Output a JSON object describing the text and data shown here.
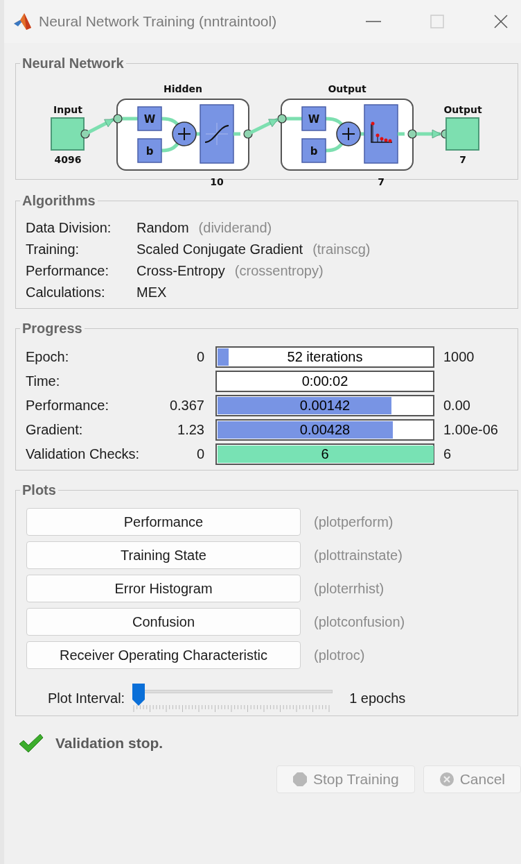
{
  "window": {
    "title": "Neural Network Training (nntraintool)"
  },
  "network": {
    "title": "Neural Network",
    "input": {
      "label": "Input",
      "size": "4096"
    },
    "layers": [
      {
        "name": "Hidden",
        "size": "10",
        "weight": "W",
        "bias": "b",
        "kind": "sigmoid"
      },
      {
        "name": "Output",
        "size": "7",
        "weight": "W",
        "bias": "b",
        "kind": "softmax"
      }
    ],
    "output": {
      "label": "Output",
      "size": "7"
    }
  },
  "algorithms": {
    "title": "Algorithms",
    "rows": [
      {
        "label": "Data Division:",
        "value": "Random",
        "function": "(dividerand)"
      },
      {
        "label": "Training:",
        "value": "Scaled Conjugate Gradient",
        "function": "(trainscg)"
      },
      {
        "label": "Performance:",
        "value": "Cross-Entropy",
        "function": "(crossentropy)"
      },
      {
        "label": "Calculations:",
        "value": "MEX"
      }
    ]
  },
  "progress": {
    "title": "Progress",
    "rows": [
      {
        "label": "Epoch:",
        "start": "0",
        "text": "52 iterations",
        "level": 0.05,
        "color": "#7894e4",
        "end": "1000"
      },
      {
        "label": "Time:",
        "text": "0:00:02"
      },
      {
        "label": "Performance:",
        "start": "0.367",
        "text": "0.00142",
        "level": 0.805,
        "color": "#7894e4",
        "end": "0.00"
      },
      {
        "label": "Gradient:",
        "start": "1.23",
        "text": "0.00428",
        "level": 0.81,
        "color": "#7894e4",
        "end": "1.00e-06"
      },
      {
        "label": "Validation Checks:",
        "start": "0",
        "text": "6",
        "level": 1,
        "color": "#78e2b4",
        "end": "6"
      }
    ]
  },
  "plots": {
    "title": "Plots",
    "buttons": [
      {
        "label": "Performance",
        "function": "(plotperform)"
      },
      {
        "label": "Training State",
        "function": "(plottrainstate)"
      },
      {
        "label": "Error Histogram",
        "function": "(ploterrhist)"
      },
      {
        "label": "Confusion",
        "function": "(plotconfusion)"
      },
      {
        "label": "Receiver Operating Characteristic",
        "function": "(plotroc)"
      }
    ],
    "interval": {
      "label": "Plot Interval:",
      "level": 0,
      "reading": "1 epochs"
    }
  },
  "status": {
    "text": "Validation stop.",
    "ok": true
  },
  "buttons": [
    {
      "label": "Stop Training",
      "kind": "stop",
      "disabled": true
    },
    {
      "label": "Cancel",
      "kind": "cancel",
      "disabled": true
    }
  ]
}
